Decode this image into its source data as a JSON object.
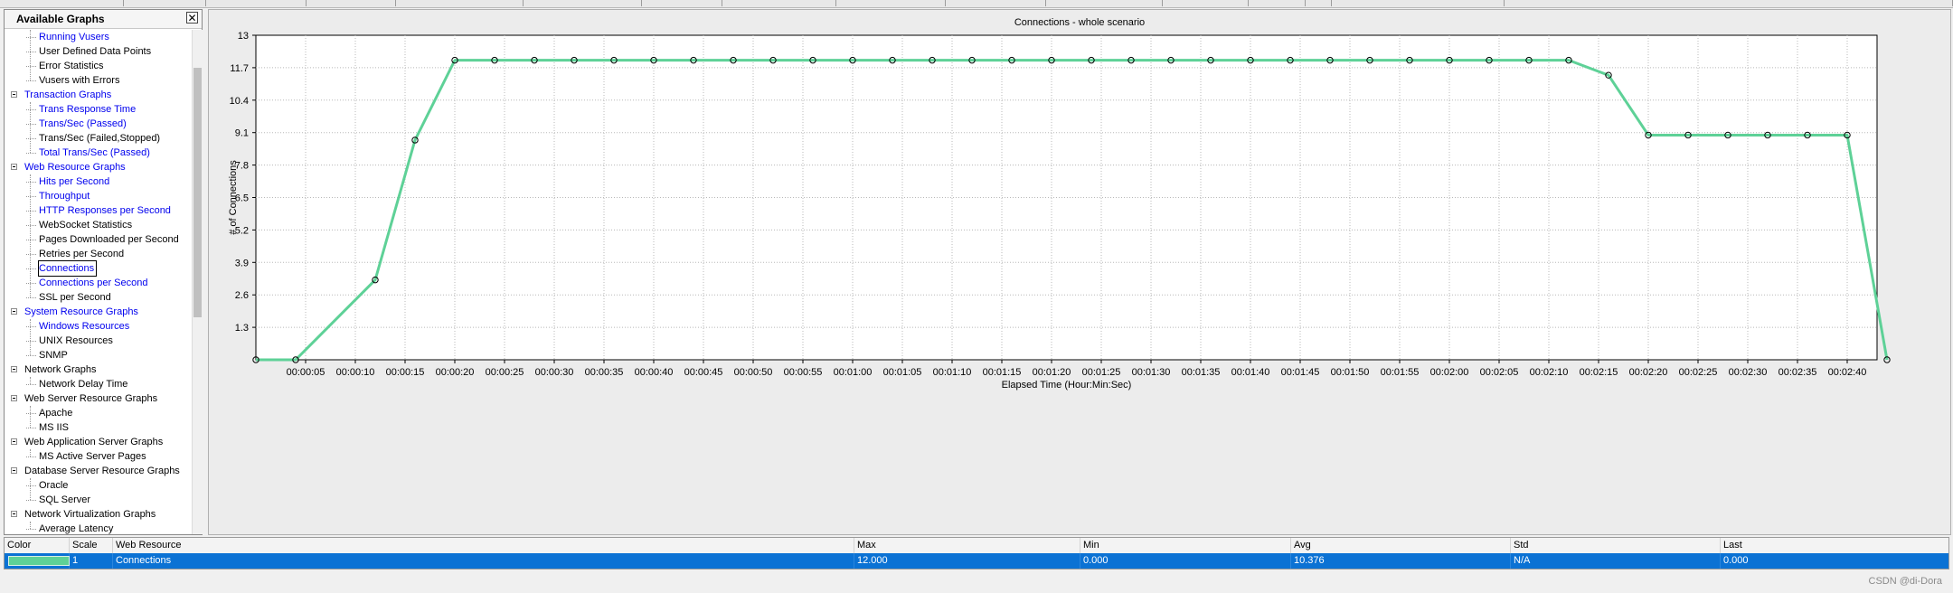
{
  "panel": {
    "title": "Available Graphs",
    "close_symbol": "✕",
    "items": [
      {
        "label": "Running Vusers",
        "level": 1,
        "color": "blue"
      },
      {
        "label": "User Defined Data Points",
        "level": 1,
        "color": "black"
      },
      {
        "label": "Error Statistics",
        "level": 1,
        "color": "black"
      },
      {
        "label": "Vusers with Errors",
        "level": 1,
        "color": "black"
      },
      {
        "label": "Transaction Graphs",
        "level": 0,
        "color": "blue"
      },
      {
        "label": "Trans Response Time",
        "level": 1,
        "color": "blue"
      },
      {
        "label": "Trans/Sec (Passed)",
        "level": 1,
        "color": "blue"
      },
      {
        "label": "Trans/Sec (Failed,Stopped)",
        "level": 1,
        "color": "black"
      },
      {
        "label": "Total Trans/Sec (Passed)",
        "level": 1,
        "color": "blue"
      },
      {
        "label": "Web Resource Graphs",
        "level": 0,
        "color": "blue"
      },
      {
        "label": "Hits per Second",
        "level": 1,
        "color": "blue"
      },
      {
        "label": "Throughput",
        "level": 1,
        "color": "blue"
      },
      {
        "label": "HTTP Responses per Second",
        "level": 1,
        "color": "blue"
      },
      {
        "label": "WebSocket Statistics",
        "level": 1,
        "color": "black"
      },
      {
        "label": "Pages Downloaded per Second",
        "level": 1,
        "color": "black"
      },
      {
        "label": "Retries per Second",
        "level": 1,
        "color": "black"
      },
      {
        "label": "Connections",
        "level": 1,
        "color": "blue",
        "selected": true
      },
      {
        "label": "Connections per Second",
        "level": 1,
        "color": "blue"
      },
      {
        "label": "SSL per Second",
        "level": 1,
        "color": "black"
      },
      {
        "label": "System Resource Graphs",
        "level": 0,
        "color": "blue"
      },
      {
        "label": "Windows Resources",
        "level": 1,
        "color": "blue"
      },
      {
        "label": "UNIX Resources",
        "level": 1,
        "color": "black"
      },
      {
        "label": "SNMP",
        "level": 1,
        "color": "black"
      },
      {
        "label": "Network Graphs",
        "level": 0,
        "color": "black"
      },
      {
        "label": "Network Delay Time",
        "level": 1,
        "color": "black"
      },
      {
        "label": "Web Server Resource Graphs",
        "level": 0,
        "color": "black"
      },
      {
        "label": "Apache",
        "level": 1,
        "color": "black"
      },
      {
        "label": "MS IIS",
        "level": 1,
        "color": "black"
      },
      {
        "label": "Web Application Server Graphs",
        "level": 0,
        "color": "black"
      },
      {
        "label": "MS Active Server Pages",
        "level": 1,
        "color": "black"
      },
      {
        "label": "Database Server Resource Graphs",
        "level": 0,
        "color": "black"
      },
      {
        "label": "Oracle",
        "level": 1,
        "color": "black"
      },
      {
        "label": "SQL Server",
        "level": 1,
        "color": "black"
      },
      {
        "label": "Network Virtualization Graphs",
        "level": 0,
        "color": "black"
      },
      {
        "label": "Average Latency",
        "level": 1,
        "color": "black"
      }
    ]
  },
  "chart_data": {
    "type": "line",
    "title": "Connections - whole scenario",
    "xlabel": "Elapsed Time (Hour:Min:Sec)",
    "ylabel": "# of Connections",
    "ylim": [
      0,
      13
    ],
    "xlim_seconds": [
      0,
      163
    ],
    "grid": true,
    "y_ticks": [
      "1.3",
      "2.6",
      "3.9",
      "5.2",
      "6.5",
      "7.8",
      "9.1",
      "10.4",
      "11.7",
      "13"
    ],
    "x_ticks": [
      "00:00:05",
      "00:00:10",
      "00:00:15",
      "00:00:20",
      "00:00:25",
      "00:00:30",
      "00:00:35",
      "00:00:40",
      "00:00:45",
      "00:00:50",
      "00:00:55",
      "00:01:00",
      "00:01:05",
      "00:01:10",
      "00:01:15",
      "00:01:20",
      "00:01:25",
      "00:01:30",
      "00:01:35",
      "00:01:40",
      "00:01:45",
      "00:01:50",
      "00:01:55",
      "00:02:00",
      "00:02:05",
      "00:02:10",
      "00:02:15",
      "00:02:20",
      "00:02:25",
      "00:02:30",
      "00:02:35",
      "00:02:40"
    ],
    "line_color": "#5ed197",
    "series": [
      {
        "name": "Connections",
        "x": [
          "00:00:00",
          "00:00:04",
          "00:00:12",
          "00:00:16",
          "00:00:20",
          "00:00:24",
          "00:00:28",
          "00:00:32",
          "00:00:36",
          "00:00:40",
          "00:00:44",
          "00:00:48",
          "00:00:52",
          "00:00:56",
          "00:01:00",
          "00:01:04",
          "00:01:08",
          "00:01:12",
          "00:01:16",
          "00:01:20",
          "00:01:24",
          "00:01:28",
          "00:01:32",
          "00:01:36",
          "00:01:40",
          "00:01:44",
          "00:01:48",
          "00:01:52",
          "00:01:56",
          "00:02:00",
          "00:02:04",
          "00:02:08",
          "00:02:12",
          "00:02:16",
          "00:02:20",
          "00:02:24",
          "00:02:28",
          "00:02:32",
          "00:02:36",
          "00:02:40",
          "00:02:44"
        ],
        "y": [
          0,
          0,
          3.2,
          8.8,
          12,
          12,
          12,
          12,
          12,
          12,
          12,
          12,
          12,
          12,
          12,
          12,
          12,
          12,
          12,
          12,
          12,
          12,
          12,
          12,
          12,
          12,
          12,
          12,
          12,
          12,
          12,
          12,
          12,
          11.4,
          9,
          9,
          9,
          9,
          9,
          9,
          0
        ]
      }
    ]
  },
  "legend": {
    "headers": {
      "color": "Color",
      "scale": "Scale",
      "resource": "Web Resource",
      "max": "Max",
      "min": "Min",
      "avg": "Avg",
      "std": "Std",
      "last": "Last"
    },
    "row": {
      "scale": "1",
      "resource": "Connections",
      "max": "12.000",
      "min": "0.000",
      "avg": "10.376",
      "std": "N/A",
      "last": "0.000",
      "color": "#5ed197"
    }
  },
  "watermark": "CSDN @di-Dora"
}
